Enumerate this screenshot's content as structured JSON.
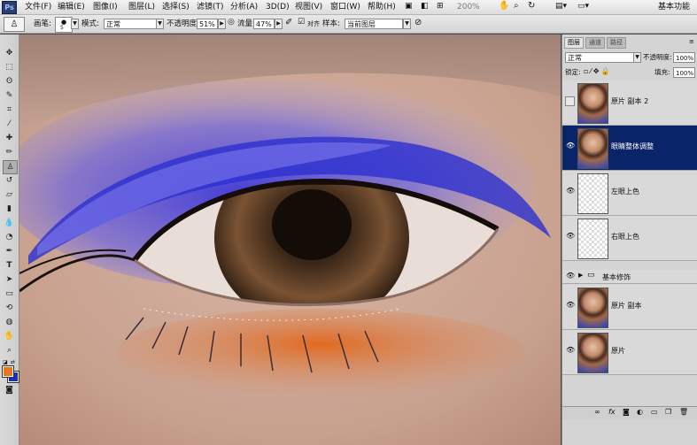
{
  "menubar": {
    "logo": "Ps",
    "items": [
      "文件(F)",
      "编辑(E)",
      "图像(I)",
      "图层(L)",
      "选择(S)",
      "滤镜(T)",
      "分析(A)",
      "3D(D)",
      "视图(V)",
      "窗口(W)",
      "帮助(H)"
    ],
    "zoom": "200%",
    "workspace": "基本功能"
  },
  "options": {
    "brush_label": "画笔:",
    "brush_size": "5",
    "mode_label": "模式:",
    "mode_value": "正常",
    "opacity_label": "不透明度:",
    "opacity_value": "51%",
    "flow_label": "流量:",
    "flow_value": "47%",
    "sample_label": "样本:",
    "sample_value": "当前图层"
  },
  "panel": {
    "tabs": [
      "图层",
      "通道",
      "路径"
    ],
    "blend_mode": "正常",
    "opacity_label": "不透明度:",
    "opacity_value": "100%",
    "lock_label": "锁定:",
    "fill_label": "填充:",
    "fill_value": "100%",
    "layers": [
      {
        "name": "原片 副本 2",
        "visible": false,
        "selected": false,
        "kind": "photo"
      },
      {
        "name": "眼睛整体调整",
        "visible": true,
        "selected": true,
        "kind": "photo"
      },
      {
        "name": "左眼上色",
        "visible": true,
        "selected": false,
        "kind": "transparent"
      },
      {
        "name": "右眼上色",
        "visible": true,
        "selected": false,
        "kind": "transparent"
      }
    ],
    "group": {
      "name": "基本修饰",
      "visible": true
    },
    "layers_bottom": [
      {
        "name": "原片 副本",
        "visible": true,
        "kind": "photo"
      },
      {
        "name": "原片",
        "visible": true,
        "kind": "photo"
      }
    ]
  },
  "colors": {
    "foreground": "#e8741c",
    "background": "#1530c8"
  }
}
